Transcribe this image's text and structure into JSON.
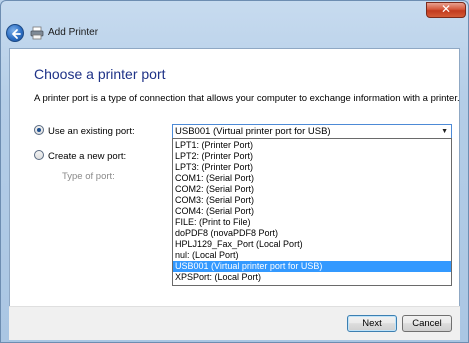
{
  "window": {
    "title": "Add Printer",
    "close_glyph": "✕"
  },
  "main": {
    "heading": "Choose a printer port",
    "description": "A printer port is a type of connection that allows your computer to exchange information with a printer.",
    "use_existing_label": "Use an existing port:",
    "create_new_label": "Create a new port:",
    "type_of_port_label": "Type of port:",
    "selected_port": "USB001 (Virtual printer port for USB)",
    "ports": [
      "LPT1: (Printer Port)",
      "LPT2: (Printer Port)",
      "LPT3: (Printer Port)",
      "COM1: (Serial Port)",
      "COM2: (Serial Port)",
      "COM3: (Serial Port)",
      "COM4: (Serial Port)",
      "FILE: (Print to File)",
      "doPDF8 (novaPDF8 Port)",
      "HPLJ129_Fax_Port (Local Port)",
      "nul: (Local Port)",
      "USB001 (Virtual printer port for USB)",
      "XPSPort: (Local Port)"
    ],
    "selected_index": 11
  },
  "footer": {
    "next_label": "Next",
    "cancel_label": "Cancel"
  },
  "colors": {
    "heading": "#1e3287",
    "selection": "#3399ff",
    "glass": "#b4cde7"
  },
  "icons": {
    "back": "back-arrow-icon",
    "printer": "printer-icon"
  }
}
